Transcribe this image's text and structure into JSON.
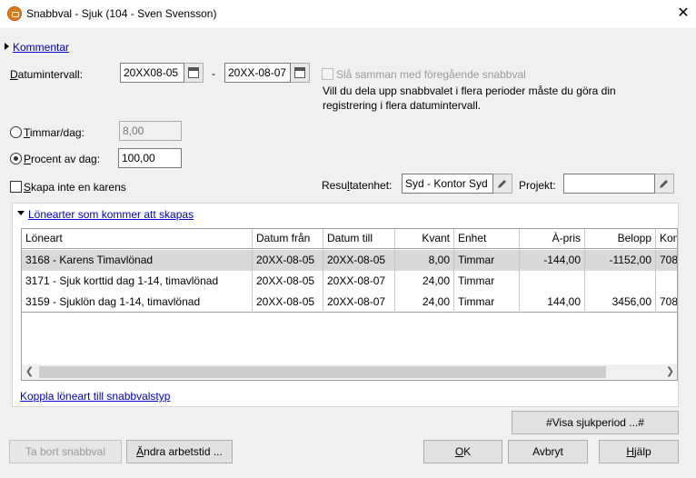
{
  "window": {
    "title": "Snabbval - Sjuk (104 - Sven Svensson)"
  },
  "comment_link": "Kommentar",
  "date_interval": {
    "label": "Datumintervall:",
    "from": "20XX08-05",
    "separator": "-",
    "to": "20XX-08-07"
  },
  "merge_checkbox": {
    "label": "Slå samman med föregående snabbval",
    "checked": false,
    "note": "Vill du dela upp snabbvalet i flera perioder måste du göra din registrering i flera datumintervall."
  },
  "hours_per_day": {
    "label": "Timmar/dag:",
    "value": "8,00",
    "selected": false
  },
  "percent_per_day": {
    "label": "Procent av dag:",
    "value": "100,00",
    "selected": true
  },
  "no_karens": {
    "label": "Skapa inte en karens",
    "checked": false
  },
  "result_unit": {
    "label": "Resultatenhet:",
    "value": "Syd - Kontor Syd"
  },
  "project": {
    "label": "Projekt:",
    "value": ""
  },
  "salary_types": {
    "link": "Lönearter som kommer att skapas",
    "columns": [
      "Löneart",
      "Datum från",
      "Datum till",
      "Kvant",
      "Enhet",
      "À-pris",
      "Belopp",
      "Kon"
    ],
    "rows": [
      {
        "loneart": "3168 - Karens Timavlönad",
        "from": "20XX-08-05",
        "to": "20XX-08-05",
        "kvant": "8,00",
        "enhet": "Timmar",
        "apris": "-144,00",
        "belopp": "-1152,00",
        "kon": "708"
      },
      {
        "loneart": "3171 - Sjuk korttid dag 1-14, timavlönad",
        "from": "20XX-08-05",
        "to": "20XX-08-07",
        "kvant": "24,00",
        "enhet": "Timmar",
        "apris": "",
        "belopp": "",
        "kon": ""
      },
      {
        "loneart": "3159 - Sjuklön dag 1-14, timavlönad",
        "from": "20XX-08-05",
        "to": "20XX-08-07",
        "kvant": "24,00",
        "enhet": "Timmar",
        "apris": "144,00",
        "belopp": "3456,00",
        "kon": "708"
      }
    ],
    "selected_row": 0,
    "connect_link": "Koppla löneart till snabbvalstyp"
  },
  "buttons": {
    "show_sick_period": "#Visa sjukperiod ...#",
    "remove": "Ta bort snabbval",
    "change_hours": "Ändra arbetstid ...",
    "ok": "OK",
    "cancel": "Avbryt",
    "help": "Hjälp"
  }
}
